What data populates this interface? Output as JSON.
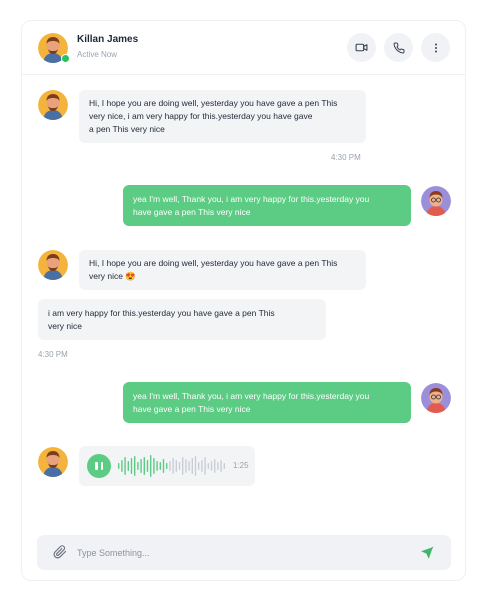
{
  "header": {
    "name": "Killan James",
    "status": "Active Now",
    "icons": [
      "video-camera-icon",
      "phone-icon",
      "more-vertical-icon"
    ]
  },
  "messages": [
    {
      "direction": "incoming",
      "text_lines": [
        "Hi, I hope you are doing well, yesterday you have gave a pen This",
        "very nice, i am very happy for this.yesterday you have gave",
        "a pen This very nice"
      ],
      "time": "4:30 PM"
    },
    {
      "direction": "outgoing",
      "text_lines": [
        "yea I'm well, Thank you, i am very happy for this.yesterday you",
        "have gave a pen This very nice"
      ]
    },
    {
      "direction": "incoming",
      "text_lines": [
        "Hi, I hope you are doing well, yesterday you have gave a pen This",
        "very nice 😍"
      ]
    },
    {
      "direction": "incoming",
      "text_lines": [
        "i am very happy for this.yesterday you have gave a pen This",
        "very nice"
      ],
      "time": "4:30 PM"
    },
    {
      "direction": "outgoing",
      "text_lines": [
        "yea I'm well, Thank you, i am very happy for this.yesterday you",
        "have gave a pen This very nice"
      ]
    }
  ],
  "voice_note": {
    "duration": "1:25",
    "progress": 0.45
  },
  "composer": {
    "placeholder": "Type Something..."
  }
}
